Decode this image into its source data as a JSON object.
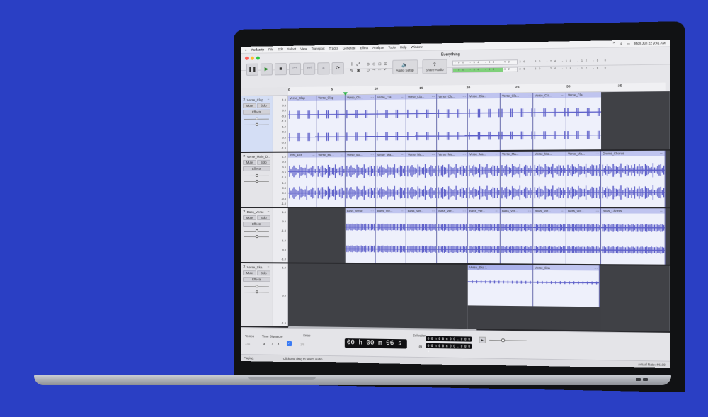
{
  "menubar": {
    "apple": "",
    "app": "Audacity",
    "items": [
      "File",
      "Edit",
      "Select",
      "View",
      "Transport",
      "Tracks",
      "Generate",
      "Effect",
      "Analyze",
      "Tools",
      "Help",
      "Window"
    ],
    "clock": "Mon Jun 22  9:41 AM"
  },
  "window": {
    "title": "Everything"
  },
  "toolbar": {
    "audio_setup": "Audio Setup",
    "share_audio": "Share Audio",
    "meter_scale": "-60 -54 -48 -42 -36 -30 -24 -18 -12 -6 0"
  },
  "ruler": {
    "ticks": [
      "0",
      "5",
      "10",
      "15",
      "20",
      "25",
      "30",
      "35"
    ]
  },
  "tracks": [
    {
      "name": "Verse_Clap",
      "mute": "Mute",
      "solo": "Solo",
      "effects": "Effects",
      "scale": [
        "1.0",
        "0.5",
        "0.0",
        "-0.5",
        "-1.0",
        "1.0",
        "0.5",
        "0.0",
        "-0.5",
        "-1.0"
      ],
      "clips": [
        "Verse_Clap",
        "Verse_Clap",
        "Verse_Cla...",
        "Verse_Cla...",
        "Verse_Cla...",
        "Verse_Cla...",
        "Verse_Cla...",
        "Verse_Cla...",
        "Verse_Cla...",
        "Verse_Cla..."
      ]
    },
    {
      "name": "Verse_Main_D...",
      "mute": "Mute",
      "solo": "Solo",
      "effects": "Effects",
      "scale": [
        "1.0",
        "0.5",
        "0.0",
        "-0.5",
        "-1.0",
        "1.0",
        "0.5",
        "0.0",
        "-0.5",
        "-1.0"
      ],
      "clips": [
        "Intro_Per...",
        "Verse_Ma...",
        "Verse_Ma...",
        "Verse_Ma...",
        "Verse_Ma...",
        "Verse_Ma...",
        "Verse_Ma...",
        "Verse_Ma...",
        "Verse_Ma...",
        "Verse_Ma...",
        "Drums_Chorus"
      ]
    },
    {
      "name": "Bass_Verse",
      "mute": "Mute",
      "solo": "Solo",
      "effects": "Effects",
      "scale": [
        "1.0",
        "0.0",
        "-1.0",
        "1.0",
        "0.0",
        "-1.0"
      ],
      "clips": [
        "Bass_Verse",
        "Bass_Ver...",
        "Bass_Ver...",
        "Bass_Ver...",
        "Bass_Ver...",
        "Bass_Ver...",
        "Bass_Ver...",
        "Bass_Ver...",
        "Bass_Chorus"
      ]
    },
    {
      "name": "Verse_Ska",
      "mute": "Mute",
      "solo": "Solo",
      "effects": "Effects",
      "scale": [
        "1.0",
        "0.0",
        "-1.0"
      ],
      "clips": [
        "Verse_Ska 1",
        "Verse_Ska"
      ]
    }
  ],
  "bottom": {
    "tempo_label": "Tempo",
    "tempo_value": "145",
    "time_sig_label": "Time Signature",
    "time_sig_num": "4",
    "time_sig_den": "4",
    "snap_label": "Snap",
    "snap_value": "1/8",
    "time": "00 h 00 m 06 s",
    "selection_label": "Selection",
    "sel_start": "0 0 h 0 0 m 0 0 . 0 0 0 s",
    "sel_end": "0 0 h 0 0 m 0 0 . 0 0 0 s"
  },
  "status": {
    "left": "Playing.",
    "middle": "Click and drag to select audio",
    "right": "Actual Rate: 44100"
  },
  "colors": {
    "background": "#2a3fc4",
    "clip": "#eef0fb",
    "clip_header": "#bfc4ef",
    "waveform": "#5d5fc9",
    "meter_active": "#7fd07a"
  }
}
